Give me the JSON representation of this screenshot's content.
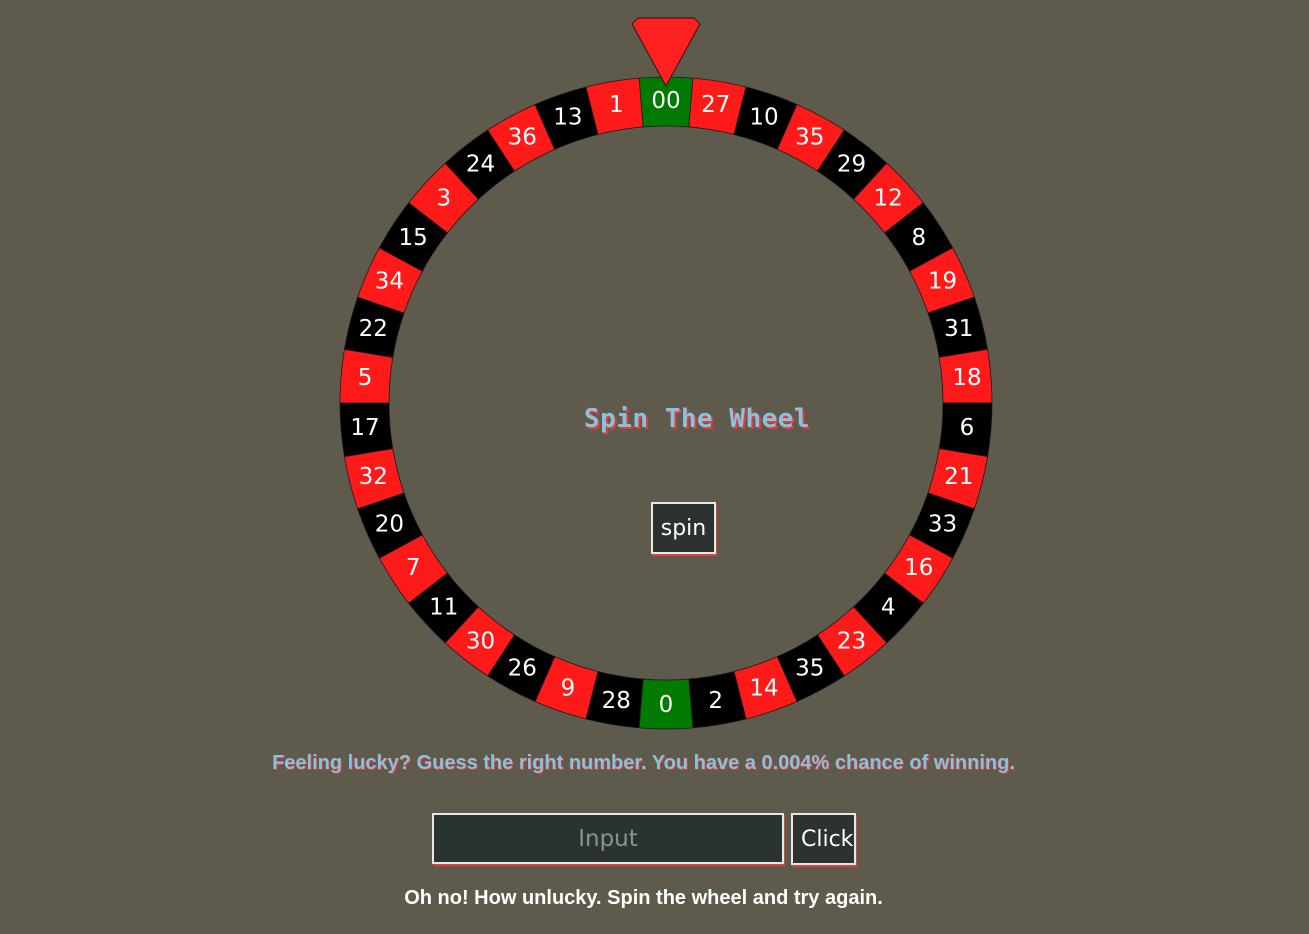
{
  "wheel": {
    "numbers": [
      "00",
      "27",
      "10",
      "35",
      "29",
      "12",
      "8",
      "19",
      "31",
      "18",
      "6",
      "21",
      "33",
      "16",
      "4",
      "23",
      "35",
      "14",
      "2",
      "0",
      "28",
      "9",
      "26",
      "30",
      "11",
      "7",
      "20",
      "32",
      "17",
      "5",
      "22",
      "34",
      "15",
      "3",
      "24",
      "36",
      "13",
      "1"
    ],
    "colors": [
      "green",
      "red",
      "black",
      "red",
      "black",
      "red",
      "black",
      "red",
      "black",
      "red",
      "black",
      "red",
      "black",
      "red",
      "black",
      "red",
      "black",
      "red",
      "black",
      "green",
      "black",
      "red",
      "black",
      "red",
      "black",
      "red",
      "black",
      "red",
      "black",
      "red",
      "black",
      "red",
      "black",
      "red",
      "black",
      "red",
      "black",
      "red"
    ],
    "color_map": {
      "red": "#ff1a1a",
      "black": "#000000",
      "green": "#007a00"
    },
    "pointer_color": "#ff2020"
  },
  "title": "Spin The Wheel",
  "spin_button": "spin",
  "lucky_message": "Feeling lucky? Guess the right number. You have a 0.004% chance of winning.",
  "guess_input": {
    "placeholder": "Input",
    "value": ""
  },
  "click_button": "Click",
  "result_message": "Oh no! How unlucky. Spin the wheel and try again."
}
